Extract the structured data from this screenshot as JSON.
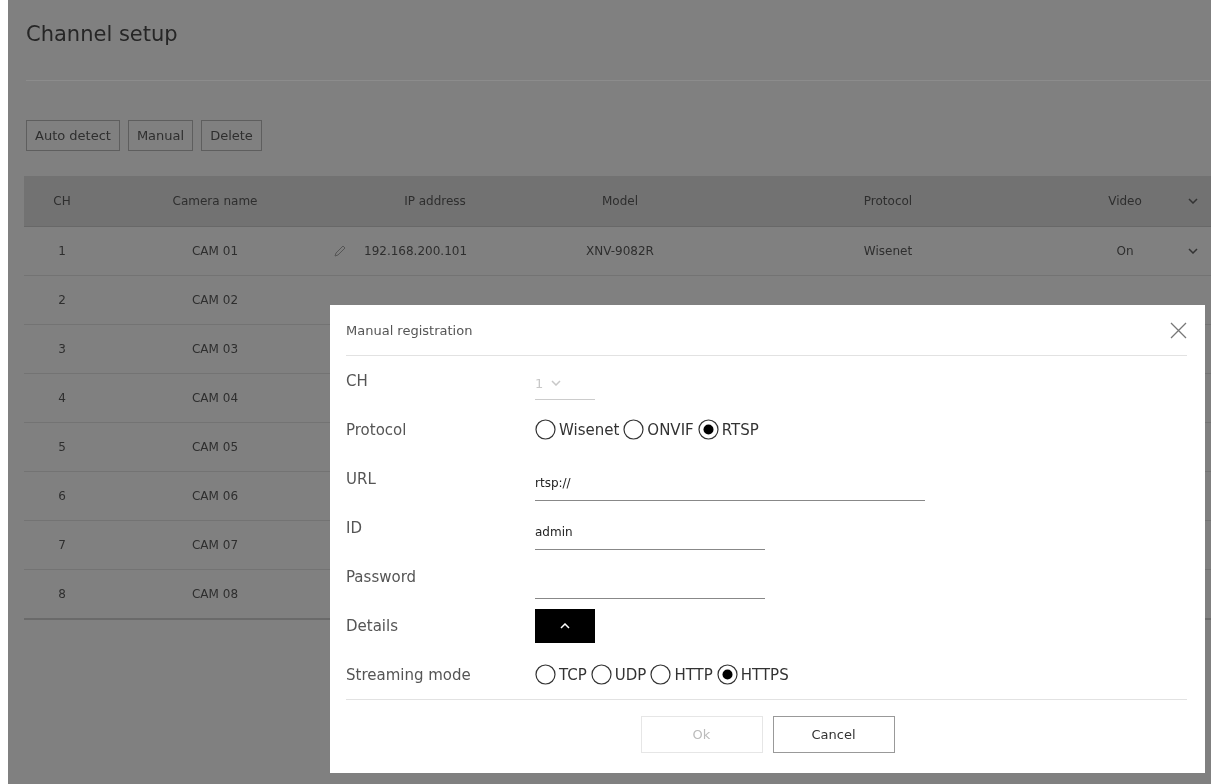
{
  "page": {
    "title": "Channel setup"
  },
  "toolbar": [
    "Auto detect",
    "Manual",
    "Delete"
  ],
  "table": {
    "columns": [
      "CH",
      "Camera name",
      "IP address",
      "Model",
      "Protocol",
      "Video"
    ],
    "rows": [
      {
        "ch": "1",
        "camera_name": "CAM 01",
        "ip_address": "192.168.200.101",
        "model": "XNV-9082R",
        "protocol": "Wisenet",
        "video": "On"
      },
      {
        "ch": "2",
        "camera_name": "CAM 02"
      },
      {
        "ch": "3",
        "camera_name": "CAM 03"
      },
      {
        "ch": "4",
        "camera_name": "CAM 04"
      },
      {
        "ch": "5",
        "camera_name": "CAM 05"
      },
      {
        "ch": "6",
        "camera_name": "CAM 06"
      },
      {
        "ch": "7",
        "camera_name": "CAM 07"
      },
      {
        "ch": "8",
        "camera_name": "CAM 08"
      }
    ]
  },
  "dialog": {
    "title": "Manual registration",
    "fields": [
      {
        "kind": "select",
        "label": "CH",
        "value": "1",
        "disabled": true
      },
      {
        "kind": "radio",
        "label": "Protocol",
        "options": [
          {
            "label": "Wisenet",
            "selected": false
          },
          {
            "label": "ONVIF",
            "selected": false
          },
          {
            "label": "RTSP",
            "selected": true
          }
        ]
      },
      {
        "kind": "text",
        "label": "URL",
        "value": "rtsp://",
        "wide": true
      },
      {
        "kind": "text",
        "label": "ID",
        "value": "admin",
        "wide": false
      },
      {
        "kind": "password",
        "label": "Password"
      },
      {
        "kind": "toggle",
        "label": "Details",
        "expanded": true
      },
      {
        "kind": "radio",
        "label": "Streaming mode",
        "options": [
          {
            "label": "TCP",
            "selected": false
          },
          {
            "label": "UDP",
            "selected": false
          },
          {
            "label": "HTTP",
            "selected": false
          },
          {
            "label": "HTTPS",
            "selected": true
          }
        ]
      }
    ],
    "buttons": [
      {
        "label": "Ok",
        "disabled": true
      },
      {
        "label": "Cancel",
        "disabled": false
      }
    ]
  }
}
